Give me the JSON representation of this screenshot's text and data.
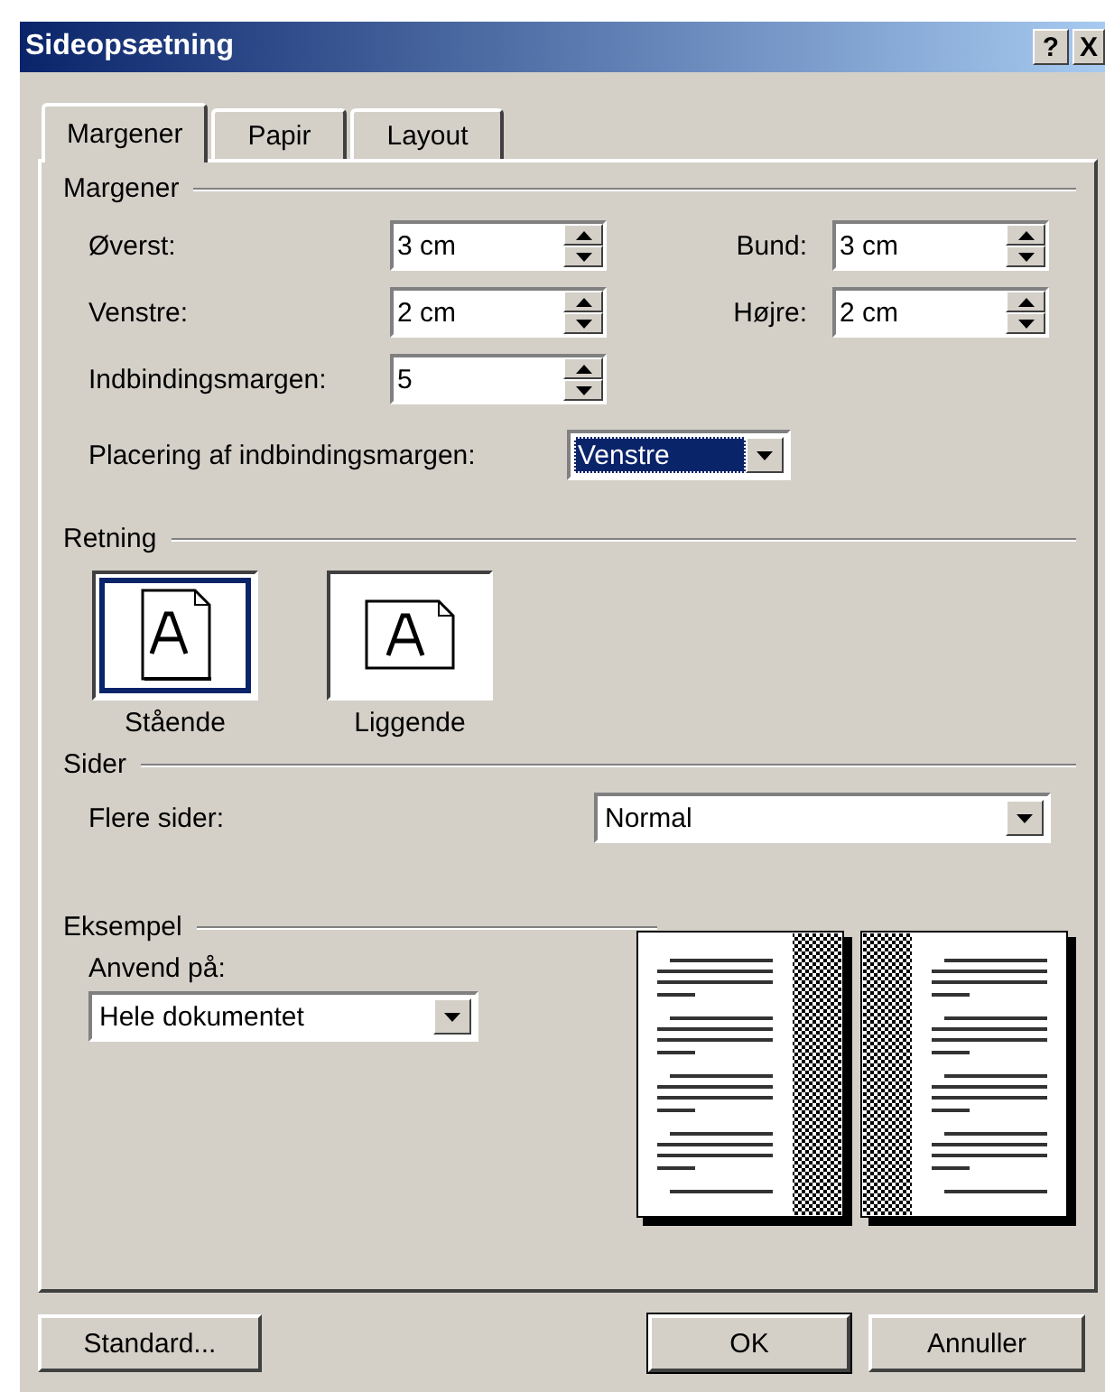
{
  "window": {
    "title": "Sideopsætning",
    "buttons": [
      {
        "label": "?",
        "kind": "help"
      },
      {
        "label": "X",
        "kind": "close"
      }
    ]
  },
  "tabs": [
    {
      "label": "Margener",
      "selected": true
    },
    {
      "label": "Papir",
      "selected": false
    },
    {
      "label": "Layout",
      "selected": false
    }
  ],
  "margins": {
    "heading": "Margener",
    "fields": [
      {
        "label": "Øverst:",
        "value": "3 cm"
      },
      {
        "label": "Bund:",
        "value": "3 cm"
      },
      {
        "label": "Venstre:",
        "value": "2 cm"
      },
      {
        "label": "Højre:",
        "value": "2 cm"
      },
      {
        "label": "Indbindingsmargen:",
        "value": "5"
      }
    ],
    "gutter_position": {
      "label": "Placering af indbindingsmargen:",
      "value": "Venstre",
      "focused": true
    }
  },
  "orientation": {
    "heading": "Retning",
    "options": [
      {
        "label": "Stående",
        "kind": "portrait",
        "selected": true
      },
      {
        "label": "Liggende",
        "kind": "landscape",
        "selected": false
      }
    ]
  },
  "pages": {
    "heading": "Sider",
    "multiple_pages": {
      "label": "Flere sider:",
      "value": "Normal"
    }
  },
  "preview": {
    "heading": "Eksempel",
    "apply_to": {
      "label": "Anvend på:",
      "value": "Hele dokumentet"
    }
  },
  "buttons": [
    {
      "label": "Standard...",
      "default": false
    },
    {
      "label": "OK",
      "default": true
    },
    {
      "label": "Annuller",
      "default": false
    }
  ]
}
